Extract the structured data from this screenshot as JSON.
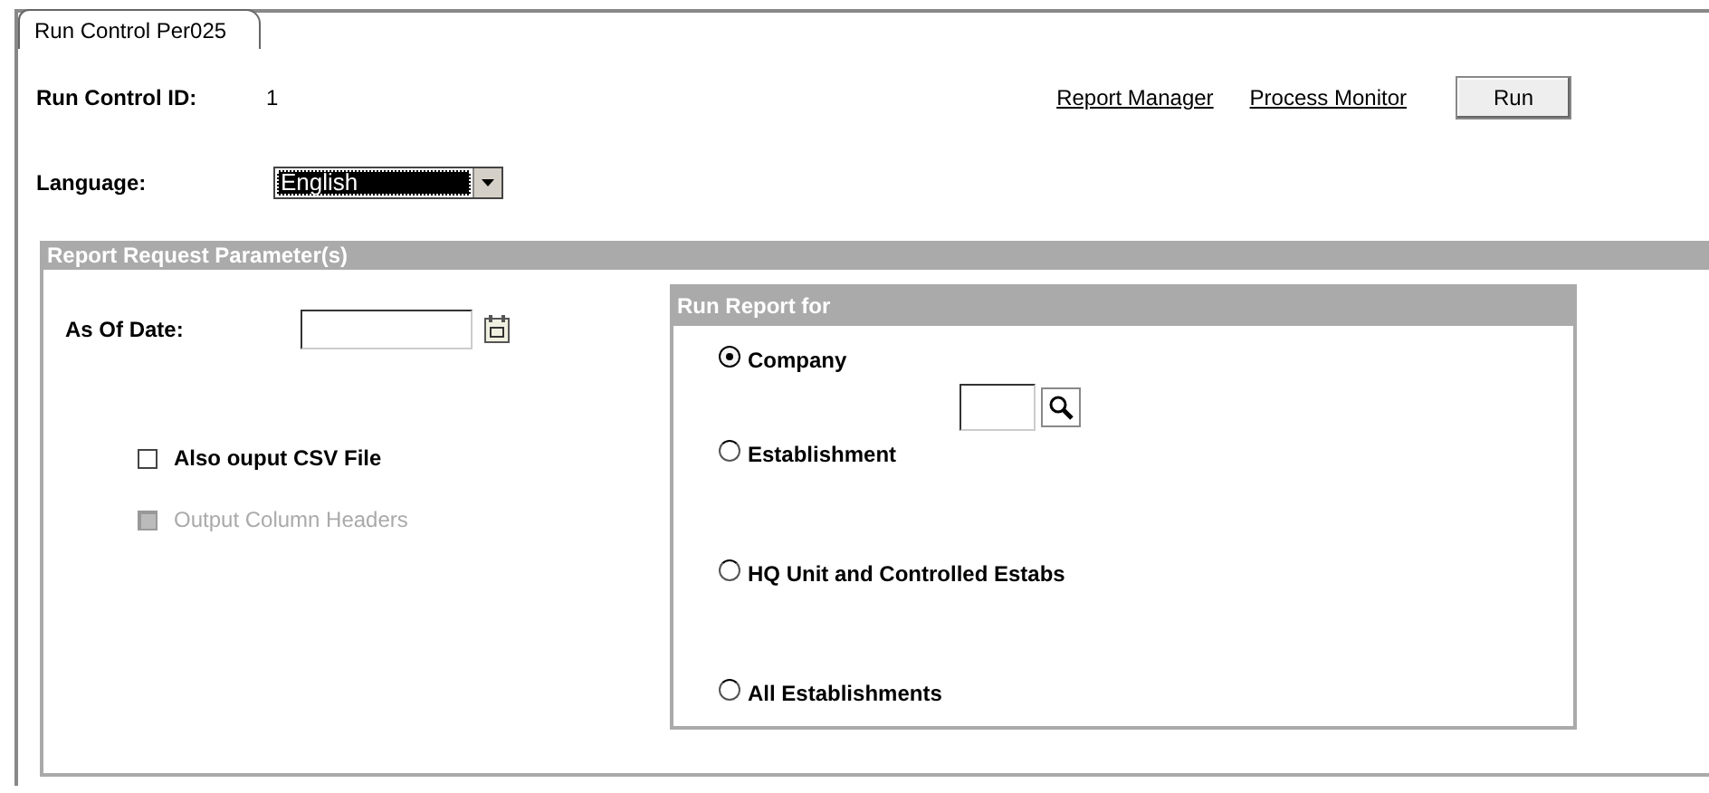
{
  "tabs": [
    {
      "label": "Run Control Per025",
      "selected": true
    }
  ],
  "run_control_id": {
    "label": "Run Control ID:",
    "value": "1"
  },
  "language": {
    "label": "Language:",
    "value": "English"
  },
  "links": [
    "Report Manager",
    "Process Monitor"
  ],
  "run_button": "Run",
  "parameters": {
    "title": "Report Request Parameter(s)",
    "as_of_date": {
      "label": "As Of Date:"
    },
    "checkboxes": [
      {
        "label": "Also ouput CSV File",
        "checked": false,
        "disabled": false
      },
      {
        "label": "Output Column Headers",
        "checked": false,
        "disabled": true
      }
    ]
  },
  "run_report_for": {
    "title": "Run Report for",
    "options": [
      {
        "label": "Company",
        "selected": true,
        "kind": "with_lookup"
      },
      {
        "label": "Establishment",
        "selected": false,
        "kind": "plain"
      },
      {
        "label": "HQ Unit and Controlled Estabs",
        "selected": false,
        "kind": "plain"
      },
      {
        "label": "All Establishments",
        "selected": false,
        "kind": "plain"
      }
    ]
  }
}
